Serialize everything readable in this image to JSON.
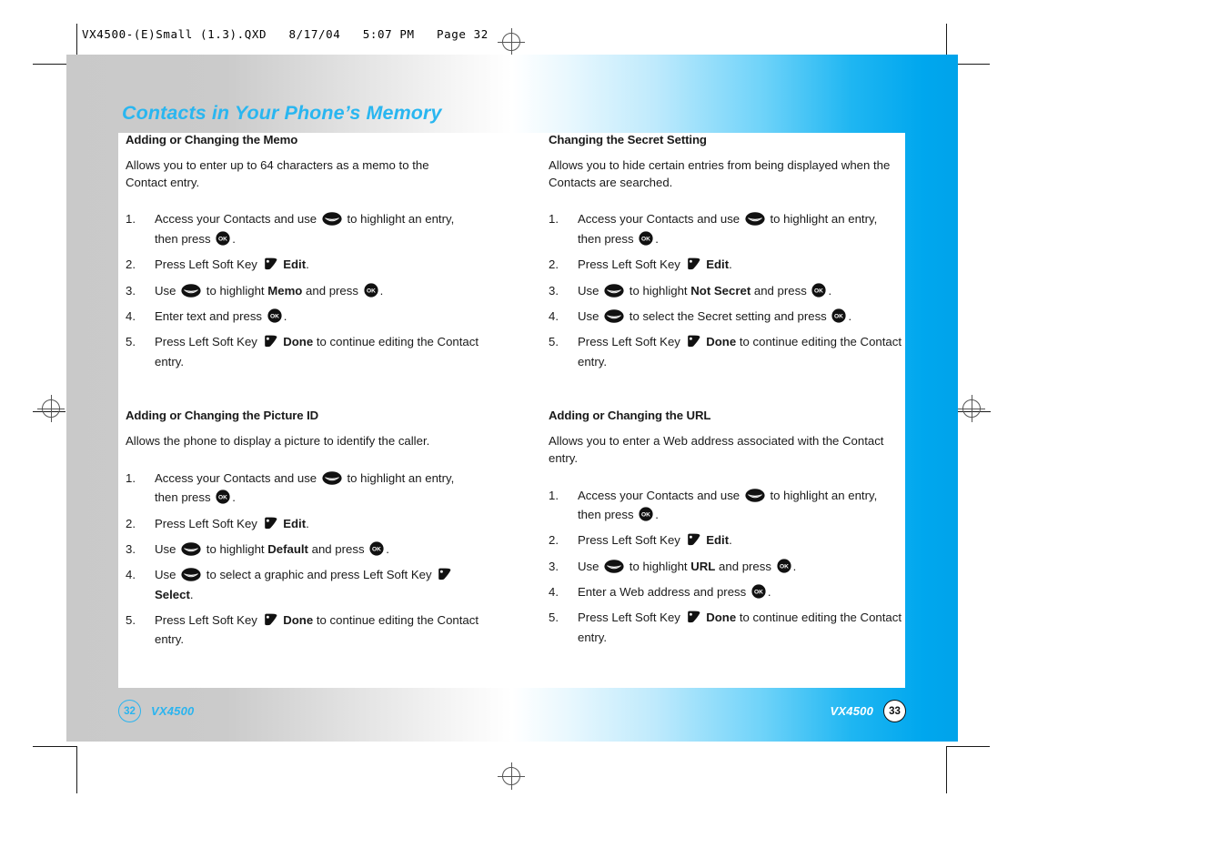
{
  "slug": "VX4500-(E)Small (1.3).QXD   8/17/04   5:07 PM   Page 32",
  "chapter_title": "Contacts in Your Phone’s Memory",
  "colors": {
    "accent_cyan": "#00a7ee",
    "title_blue": "#29b6f0",
    "folio_blue": "#2ab4ef",
    "body_black": "#1a1a1a",
    "panel_white": "#ffffff",
    "page_gray": "#c9c9c9"
  },
  "icons": {
    "nav": "navigation-key-icon",
    "ok": "ok-key-icon",
    "softkey": "left-soft-key-icon",
    "ok_label": "OK"
  },
  "left_column": [
    {
      "id": "memo",
      "title": "Adding or Changing the Memo",
      "intro": "Allows you to enter up to 64 characters as a memo to the Contact entry.",
      "steps": [
        [
          {
            "t": "text",
            "v": "Access your Contacts and use "
          },
          {
            "t": "icon",
            "v": "nav"
          },
          {
            "t": "text",
            "v": " to highlight an entry, then press "
          },
          {
            "t": "icon",
            "v": "ok"
          },
          {
            "t": "text",
            "v": "."
          }
        ],
        [
          {
            "t": "text",
            "v": "Press Left Soft Key "
          },
          {
            "t": "icon",
            "v": "softkey"
          },
          {
            "t": "bold",
            "v": " Edit"
          },
          {
            "t": "text",
            "v": "."
          }
        ],
        [
          {
            "t": "text",
            "v": "Use "
          },
          {
            "t": "icon",
            "v": "nav"
          },
          {
            "t": "text",
            "v": " to highlight "
          },
          {
            "t": "bold",
            "v": "Memo"
          },
          {
            "t": "text",
            "v": " and press "
          },
          {
            "t": "icon",
            "v": "ok"
          },
          {
            "t": "text",
            "v": "."
          }
        ],
        [
          {
            "t": "text",
            "v": "Enter text and press "
          },
          {
            "t": "icon",
            "v": "ok"
          },
          {
            "t": "text",
            "v": "."
          }
        ],
        [
          {
            "t": "text",
            "v": "Press Left Soft Key "
          },
          {
            "t": "icon",
            "v": "softkey"
          },
          {
            "t": "bold",
            "v": " Done"
          },
          {
            "t": "text",
            "v": " to continue editing the Contact entry."
          }
        ]
      ]
    },
    {
      "id": "picture-id",
      "title": "Adding or Changing the Picture ID",
      "intro": "Allows the phone to display a picture to identify the caller.",
      "steps": [
        [
          {
            "t": "text",
            "v": "Access your Contacts and use "
          },
          {
            "t": "icon",
            "v": "nav"
          },
          {
            "t": "text",
            "v": " to highlight an entry, then press "
          },
          {
            "t": "icon",
            "v": "ok"
          },
          {
            "t": "text",
            "v": "."
          }
        ],
        [
          {
            "t": "text",
            "v": "Press Left Soft Key "
          },
          {
            "t": "icon",
            "v": "softkey"
          },
          {
            "t": "bold",
            "v": " Edit"
          },
          {
            "t": "text",
            "v": "."
          }
        ],
        [
          {
            "t": "text",
            "v": "Use "
          },
          {
            "t": "icon",
            "v": "nav"
          },
          {
            "t": "text",
            "v": " to highlight "
          },
          {
            "t": "bold",
            "v": "Default"
          },
          {
            "t": "text",
            "v": " and press "
          },
          {
            "t": "icon",
            "v": "ok"
          },
          {
            "t": "text",
            "v": "."
          }
        ],
        [
          {
            "t": "text",
            "v": "Use "
          },
          {
            "t": "icon",
            "v": "nav"
          },
          {
            "t": "text",
            "v": " to select a graphic and press Left Soft Key "
          },
          {
            "t": "icon",
            "v": "softkey"
          },
          {
            "t": "bold",
            "v": " Select"
          },
          {
            "t": "text",
            "v": "."
          }
        ],
        [
          {
            "t": "text",
            "v": "Press Left Soft Key "
          },
          {
            "t": "icon",
            "v": "softkey"
          },
          {
            "t": "bold",
            "v": " Done"
          },
          {
            "t": "text",
            "v": " to continue editing the Contact entry."
          }
        ]
      ]
    }
  ],
  "right_column": [
    {
      "id": "secret-setting",
      "title": "Changing the Secret Setting",
      "intro": "Allows you to hide certain entries from being displayed when the Contacts are searched.",
      "steps": [
        [
          {
            "t": "text",
            "v": "Access your Contacts and use "
          },
          {
            "t": "icon",
            "v": "nav"
          },
          {
            "t": "text",
            "v": " to highlight an entry, then press "
          },
          {
            "t": "icon",
            "v": "ok"
          },
          {
            "t": "text",
            "v": "."
          }
        ],
        [
          {
            "t": "text",
            "v": "Press Left Soft Key "
          },
          {
            "t": "icon",
            "v": "softkey"
          },
          {
            "t": "bold",
            "v": " Edit"
          },
          {
            "t": "text",
            "v": "."
          }
        ],
        [
          {
            "t": "text",
            "v": "Use "
          },
          {
            "t": "icon",
            "v": "nav"
          },
          {
            "t": "text",
            "v": " to highlight "
          },
          {
            "t": "bold",
            "v": "Not Secret"
          },
          {
            "t": "text",
            "v": " and press "
          },
          {
            "t": "icon",
            "v": "ok"
          },
          {
            "t": "text",
            "v": "."
          }
        ],
        [
          {
            "t": "text",
            "v": "Use "
          },
          {
            "t": "icon",
            "v": "nav"
          },
          {
            "t": "text",
            "v": " to select the Secret setting and press "
          },
          {
            "t": "icon",
            "v": "ok"
          },
          {
            "t": "text",
            "v": "."
          }
        ],
        [
          {
            "t": "text",
            "v": "Press Left Soft Key "
          },
          {
            "t": "icon",
            "v": "softkey"
          },
          {
            "t": "bold",
            "v": " Done"
          },
          {
            "t": "text",
            "v": " to continue editing the Contact entry."
          }
        ]
      ]
    },
    {
      "id": "url",
      "title": "Adding or Changing the URL",
      "intro": "Allows you to enter a Web address associated with the Contact entry.",
      "steps": [
        [
          {
            "t": "text",
            "v": "Access your Contacts and use "
          },
          {
            "t": "icon",
            "v": "nav"
          },
          {
            "t": "text",
            "v": " to highlight an entry, then press "
          },
          {
            "t": "icon",
            "v": "ok"
          },
          {
            "t": "text",
            "v": "."
          }
        ],
        [
          {
            "t": "text",
            "v": "Press Left Soft Key "
          },
          {
            "t": "icon",
            "v": "softkey"
          },
          {
            "t": "bold",
            "v": " Edit"
          },
          {
            "t": "text",
            "v": "."
          }
        ],
        [
          {
            "t": "text",
            "v": "Use "
          },
          {
            "t": "icon",
            "v": "nav"
          },
          {
            "t": "text",
            "v": " to highlight "
          },
          {
            "t": "bold",
            "v": "URL"
          },
          {
            "t": "text",
            "v": " and press "
          },
          {
            "t": "icon",
            "v": "ok"
          },
          {
            "t": "text",
            "v": "."
          }
        ],
        [
          {
            "t": "text",
            "v": "Enter a Web address and press "
          },
          {
            "t": "icon",
            "v": "ok"
          },
          {
            "t": "text",
            "v": "."
          }
        ],
        [
          {
            "t": "text",
            "v": "Press Left Soft Key "
          },
          {
            "t": "icon",
            "v": "softkey"
          },
          {
            "t": "bold",
            "v": " Done"
          },
          {
            "t": "text",
            "v": " to continue editing the Contact entry."
          }
        ]
      ]
    }
  ],
  "footer": {
    "left_page": "32",
    "left_brand": "VX4500",
    "right_brand": "VX4500",
    "right_page": "33"
  }
}
